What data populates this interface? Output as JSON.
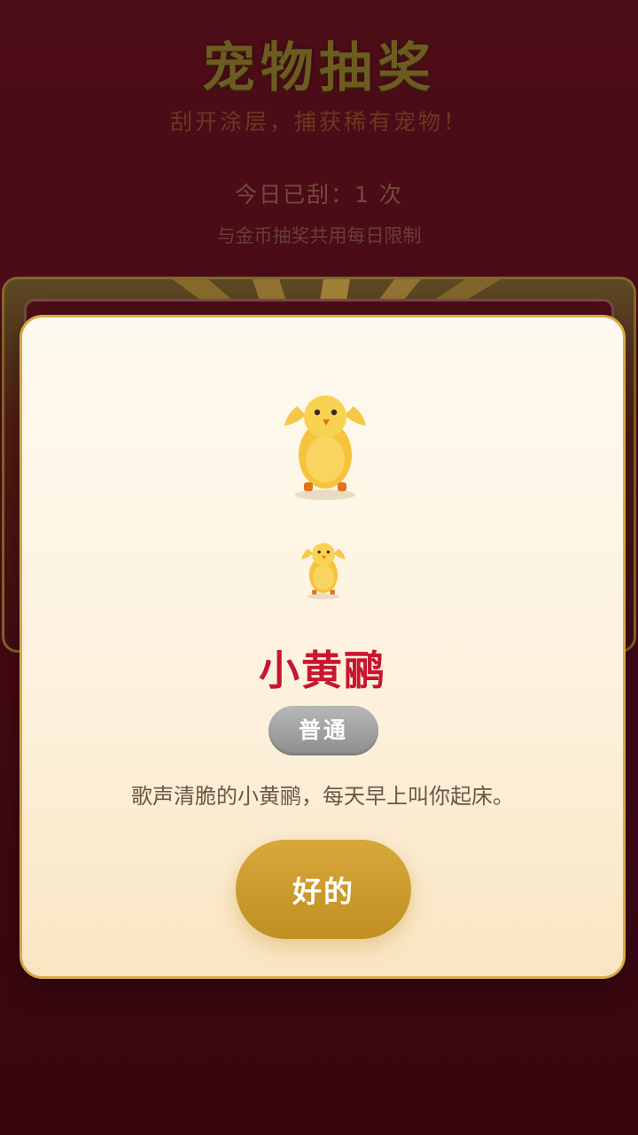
{
  "page": {
    "title": "宠物抽奖",
    "subtitle": "刮开涂层，捕获稀有宠物！",
    "scratch_count": "今日已刮：1 次",
    "limit_note": "与金币抽奖共用每日限制"
  },
  "result_modal": {
    "pet_name": "小黄鹂",
    "rarity": "普通",
    "description": "歌声清脆的小黄鹂，每天早上叫你起床。",
    "confirm_label": "好的",
    "pet_icon": "yellow-oriole-icon"
  },
  "colors": {
    "background": "#5a101c",
    "gold": "#d9a845",
    "button": "#c9982c",
    "pet_name": "#c8162f",
    "rarity_badge": "#a0a0a0",
    "modal_bg": "#fdf3e0"
  }
}
